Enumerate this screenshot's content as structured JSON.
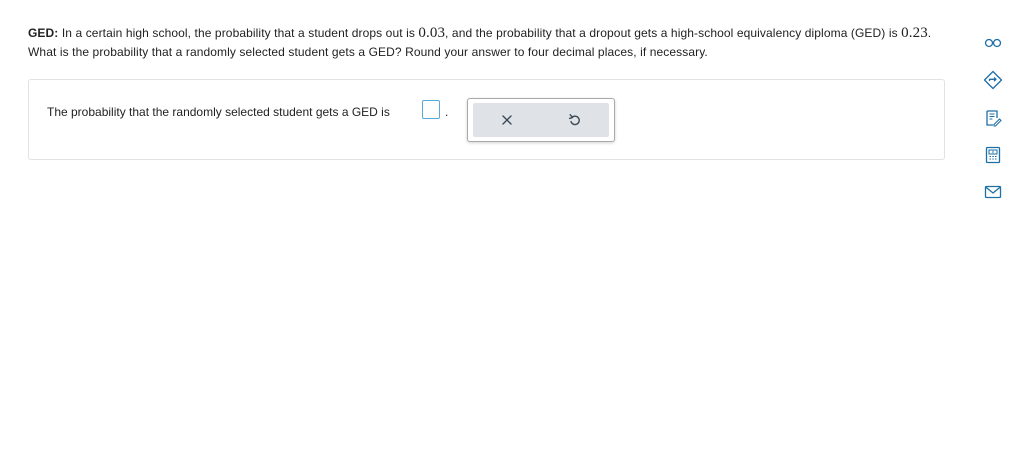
{
  "question": {
    "lead": "GED:",
    "part1": " In a certain high school, the probability that a student drops out is ",
    "dropout_prob": "0.03",
    "part2": ", and the probability that a dropout gets a high-school equivalency diploma (GED) is ",
    "ged_prob": "0.23",
    "part3": ". What is the probability that a randomly selected student gets a GED? Round your answer to four decimal places, if necessary."
  },
  "answer": {
    "prompt": "The probability that the randomly selected student gets a GED is",
    "value": "",
    "end_punct": "."
  },
  "tools": {
    "clear_icon": "close-icon",
    "undo_icon": "undo-icon"
  },
  "side_rail": {
    "icons": [
      "glasses-icon",
      "diamond-arrow-icon",
      "notebook-icon",
      "calculator-icon",
      "mail-icon"
    ]
  },
  "colors": {
    "accent": "#5aa9d6",
    "icon": "#1e6fa8",
    "tool_bg": "#dfe3e7"
  }
}
